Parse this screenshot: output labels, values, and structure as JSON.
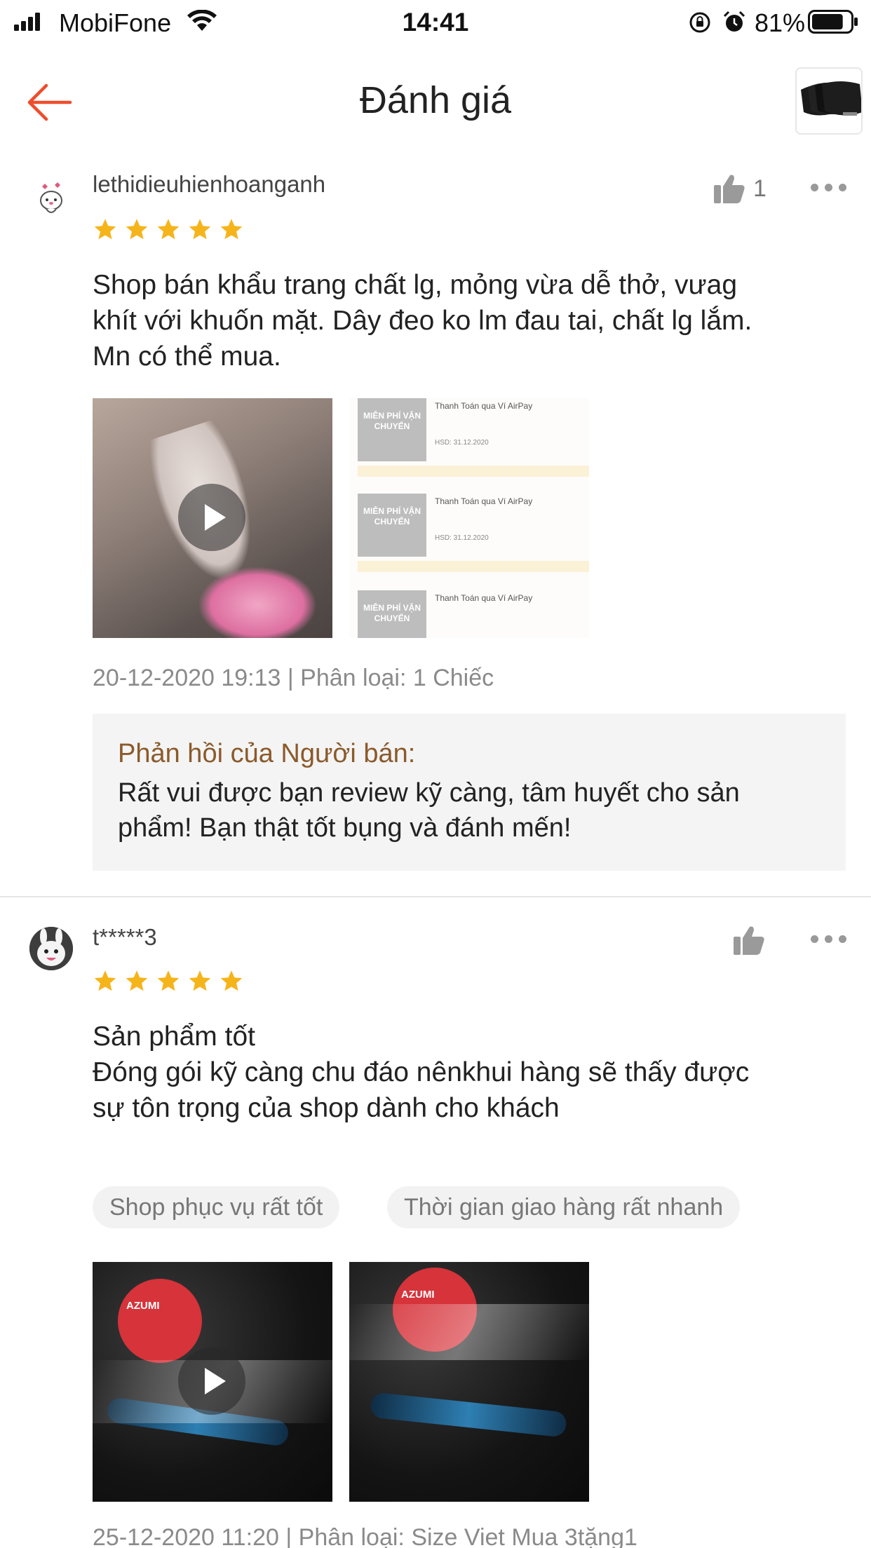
{
  "status_bar": {
    "carrier": "MobiFone",
    "time": "14:41",
    "battery_percent": "81%",
    "battery_level": 0.81
  },
  "header": {
    "title": "Đánh giá",
    "back_icon": "arrow-left-icon",
    "accent_color": "#ee4d2d"
  },
  "reviews": [
    {
      "username": "lethidieuhienhoanganh",
      "avatar_icon": "cartoon-avatar",
      "rating": 5,
      "like_count": "1",
      "text": "Shop bán khẩu trang chất lg, mỏng vừa dễ thở, vưag\nkhít với khuốn mặt. Dây đeo ko lm đau tai, chất lg lắm.\nMn có thể mua.",
      "media": [
        {
          "type": "video",
          "icon": "play-icon"
        },
        {
          "type": "image"
        }
      ],
      "meta": "20-12-2020 19:13 | Phân loại: 1 Chiếc",
      "seller_reply": {
        "label": "Phản hồi của Người bán:",
        "text": "Rất vui được bạn review kỹ càng, tâm huyết cho sản phẩm! Bạn thật tốt bụng và đánh mến!"
      }
    },
    {
      "username": "t*****3",
      "avatar_icon": "bunny-avatar",
      "rating": 5,
      "text": "Sản phẩm tốt\nĐóng gói kỹ càng chu đáo nênkhui hàng sẽ thấy được\nsự tôn trọng của shop dành cho khách",
      "tags": [
        "Shop phục vụ rất tốt",
        "Thời gian giao hàng rất nhanh"
      ],
      "media": [
        {
          "type": "video",
          "icon": "play-icon"
        },
        {
          "type": "image"
        }
      ],
      "meta": "25-12-2020 11:20 | Phân loại: Size Viet Mua 3tặng1"
    }
  ],
  "voucher_image": {
    "badge": "MIỄN PHÍ VẬN CHUYỂN",
    "title": "Thanh Toán qua Ví AirPay",
    "date": "HSD: 31.12.2020"
  },
  "mask_brand": "AZUMI",
  "colors": {
    "star": "#f6b41b",
    "seller_label": "#8b5a2b",
    "meta_text": "#8a8a8a"
  }
}
